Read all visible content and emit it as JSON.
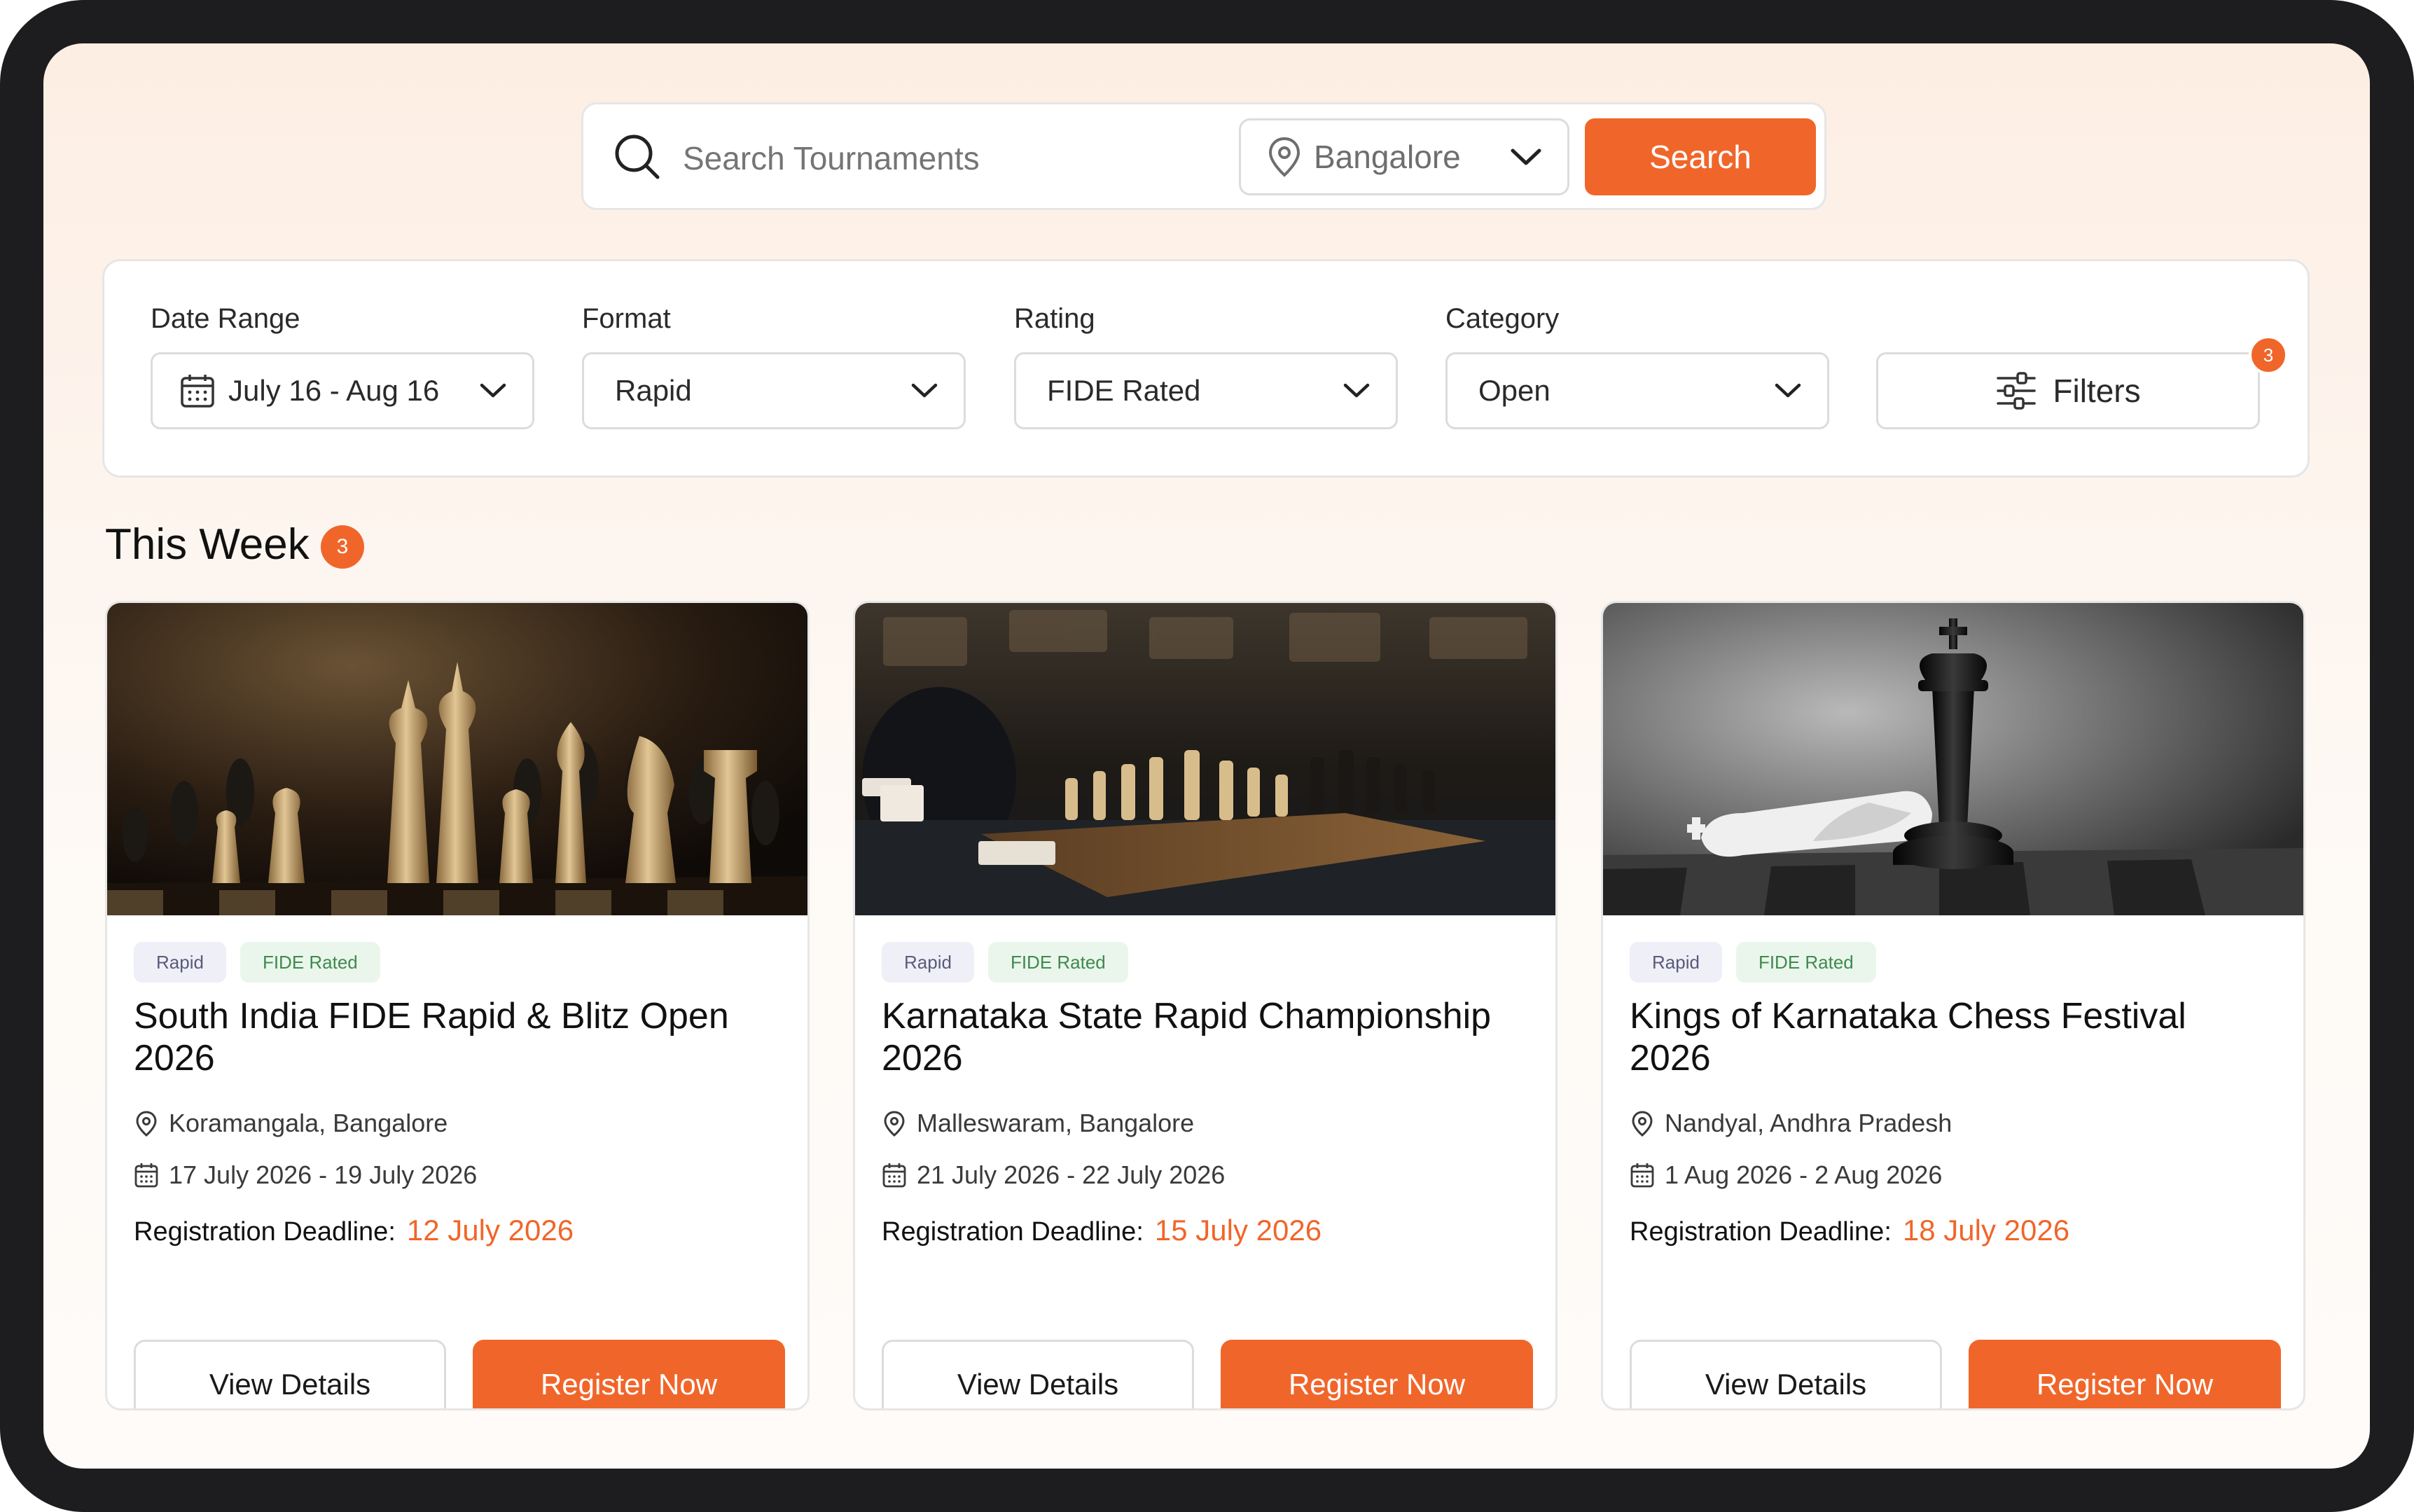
{
  "search": {
    "placeholder": "Search Tournaments",
    "location": "Bangalore",
    "button_label": "Search"
  },
  "filters": {
    "date_range": {
      "label": "Date Range",
      "value": "July 16 - Aug 16"
    },
    "format": {
      "label": "Format",
      "value": "Rapid"
    },
    "rating": {
      "label": "Rating",
      "value": "FIDE Rated"
    },
    "category": {
      "label": "Category",
      "value": "Open"
    },
    "more": {
      "label": "Filters",
      "badge": "3"
    }
  },
  "section": {
    "title": "This Week",
    "count": "3"
  },
  "cards": [
    {
      "image": "chess-pieces-gold-photo",
      "tags": [
        "Rapid",
        "FIDE Rated"
      ],
      "title": "South India FIDE Rapid & Blitz Open 2026",
      "location": "Koramangala, Bangalore",
      "dates": "17 July 2026 - 19 July 2026",
      "deadline_label": "Registration Deadline:",
      "deadline": "12 July 2026",
      "details_label": "View Details",
      "register_label": "Register Now"
    },
    {
      "image": "tournament-hall-photo",
      "tags": [
        "Rapid",
        "FIDE Rated"
      ],
      "title": "Karnataka State Rapid Championship 2026",
      "location": "Malleswaram, Bangalore",
      "dates": "21 July 2026 - 22 July 2026",
      "deadline_label": "Registration Deadline:",
      "deadline": "15 July 2026",
      "details_label": "View Details",
      "register_label": "Register Now"
    },
    {
      "image": "king-checkmate-photo",
      "tags": [
        "Rapid",
        "FIDE Rated"
      ],
      "title": "Kings of Karnataka Chess Festival 2026",
      "location": "Nandyal, Andhra Pradesh",
      "dates": "1 Aug 2026 - 2 Aug 2026",
      "deadline_label": "Registration Deadline:",
      "deadline": "18 July 2026",
      "details_label": "View Details",
      "register_label": "Register Now"
    }
  ],
  "colors": {
    "accent": "#f0662a",
    "rated_tag": "#3f8a4e",
    "format_tag": "#5a5a7a"
  }
}
